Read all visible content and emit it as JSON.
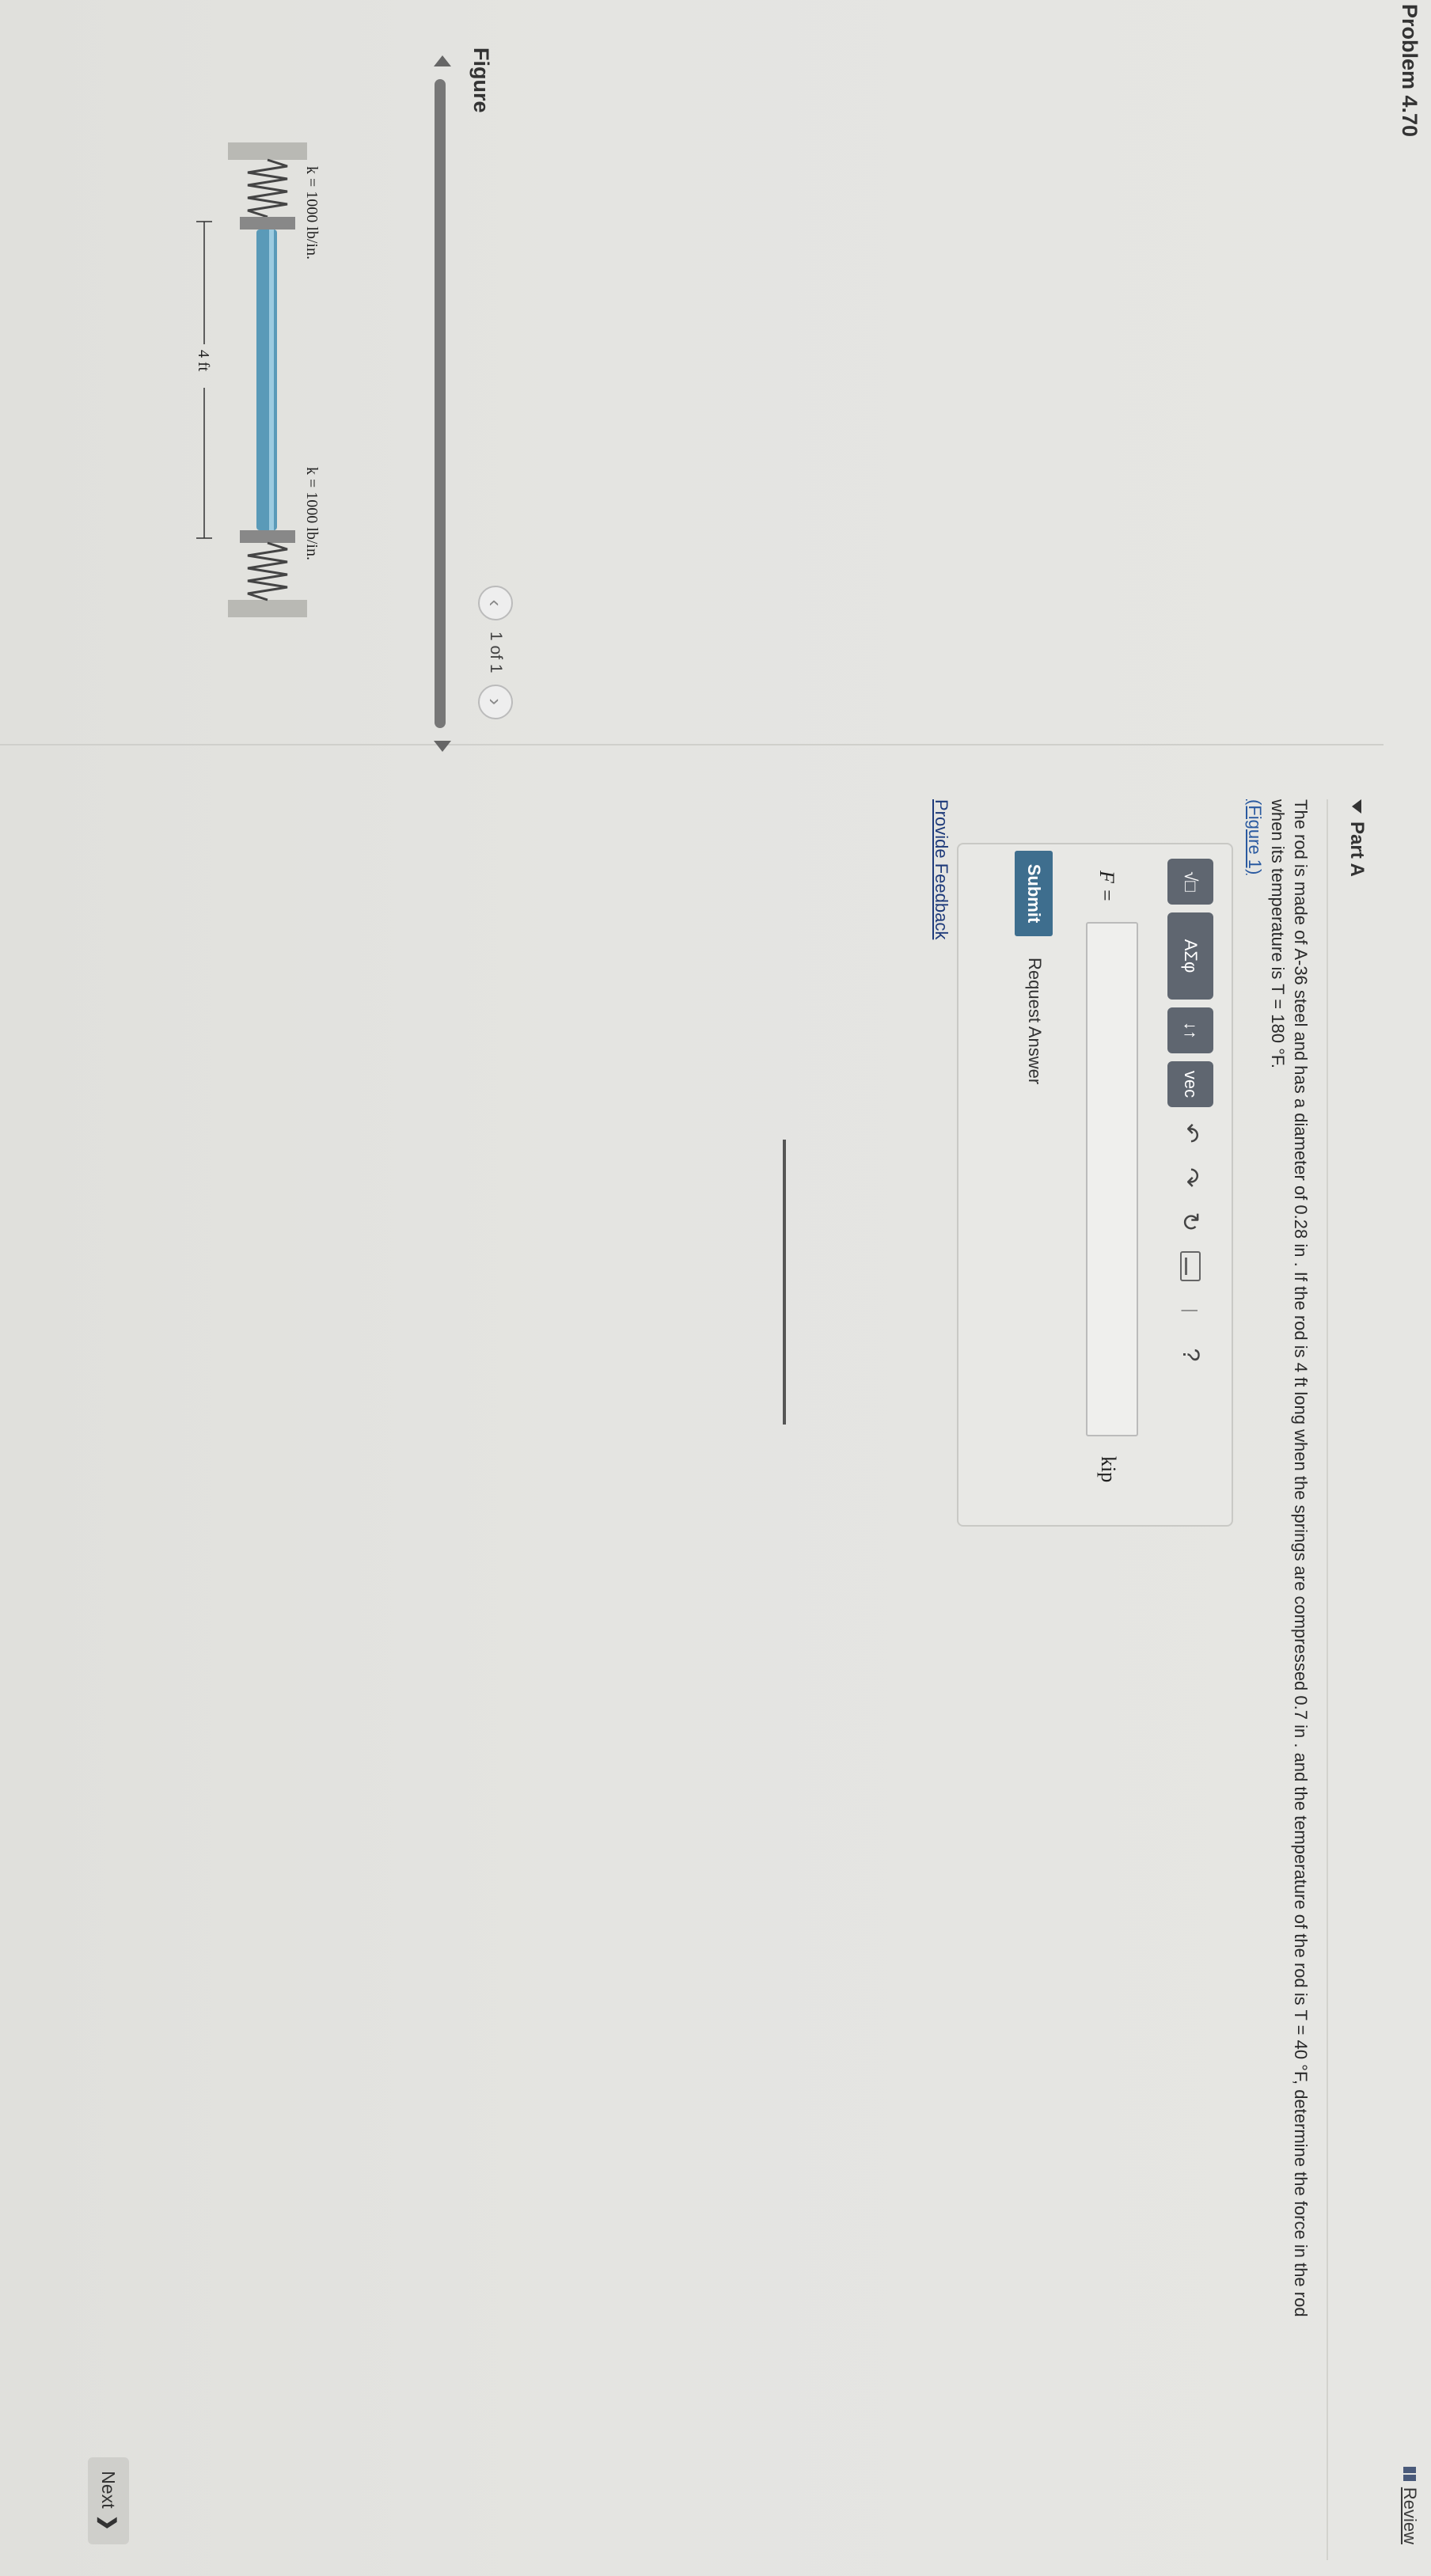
{
  "header": {
    "title": "Problem 4.70",
    "review_label": "Review"
  },
  "figure": {
    "heading": "Figure",
    "k_left": "k = 1000 lb/in.",
    "k_right": "k = 1000 lb/in.",
    "length": "4 ft",
    "pager": {
      "text": "1 of 1"
    }
  },
  "part": {
    "label": "Part A",
    "statement_line1": "The rod is made of A-36 steel and has a diameter of 0.28 in . If the rod is 4 ft long when the springs are compressed 0.7 in . and the temperature of the rod is T = 40 °F, determine the force in the rod",
    "statement_line2": "when its temperature is T = 180 °F.",
    "figure_link": "(Figure 1)"
  },
  "toolbar": {
    "templates": "√□",
    "greek": "ΑΣφ",
    "updown": "↓↑",
    "vec": "vec",
    "undo": "↶",
    "redo": "↷",
    "reset": "↻",
    "help": "?"
  },
  "answer": {
    "variable": "F =",
    "value": "",
    "unit": "kip"
  },
  "actions": {
    "submit": "Submit",
    "request_answer": "Request Answer",
    "feedback": "Provide Feedback",
    "next": "Next"
  },
  "colors": {
    "submit": "#3e6e8e",
    "rod": "#5a9ab8",
    "link": "#2a5aa0"
  }
}
